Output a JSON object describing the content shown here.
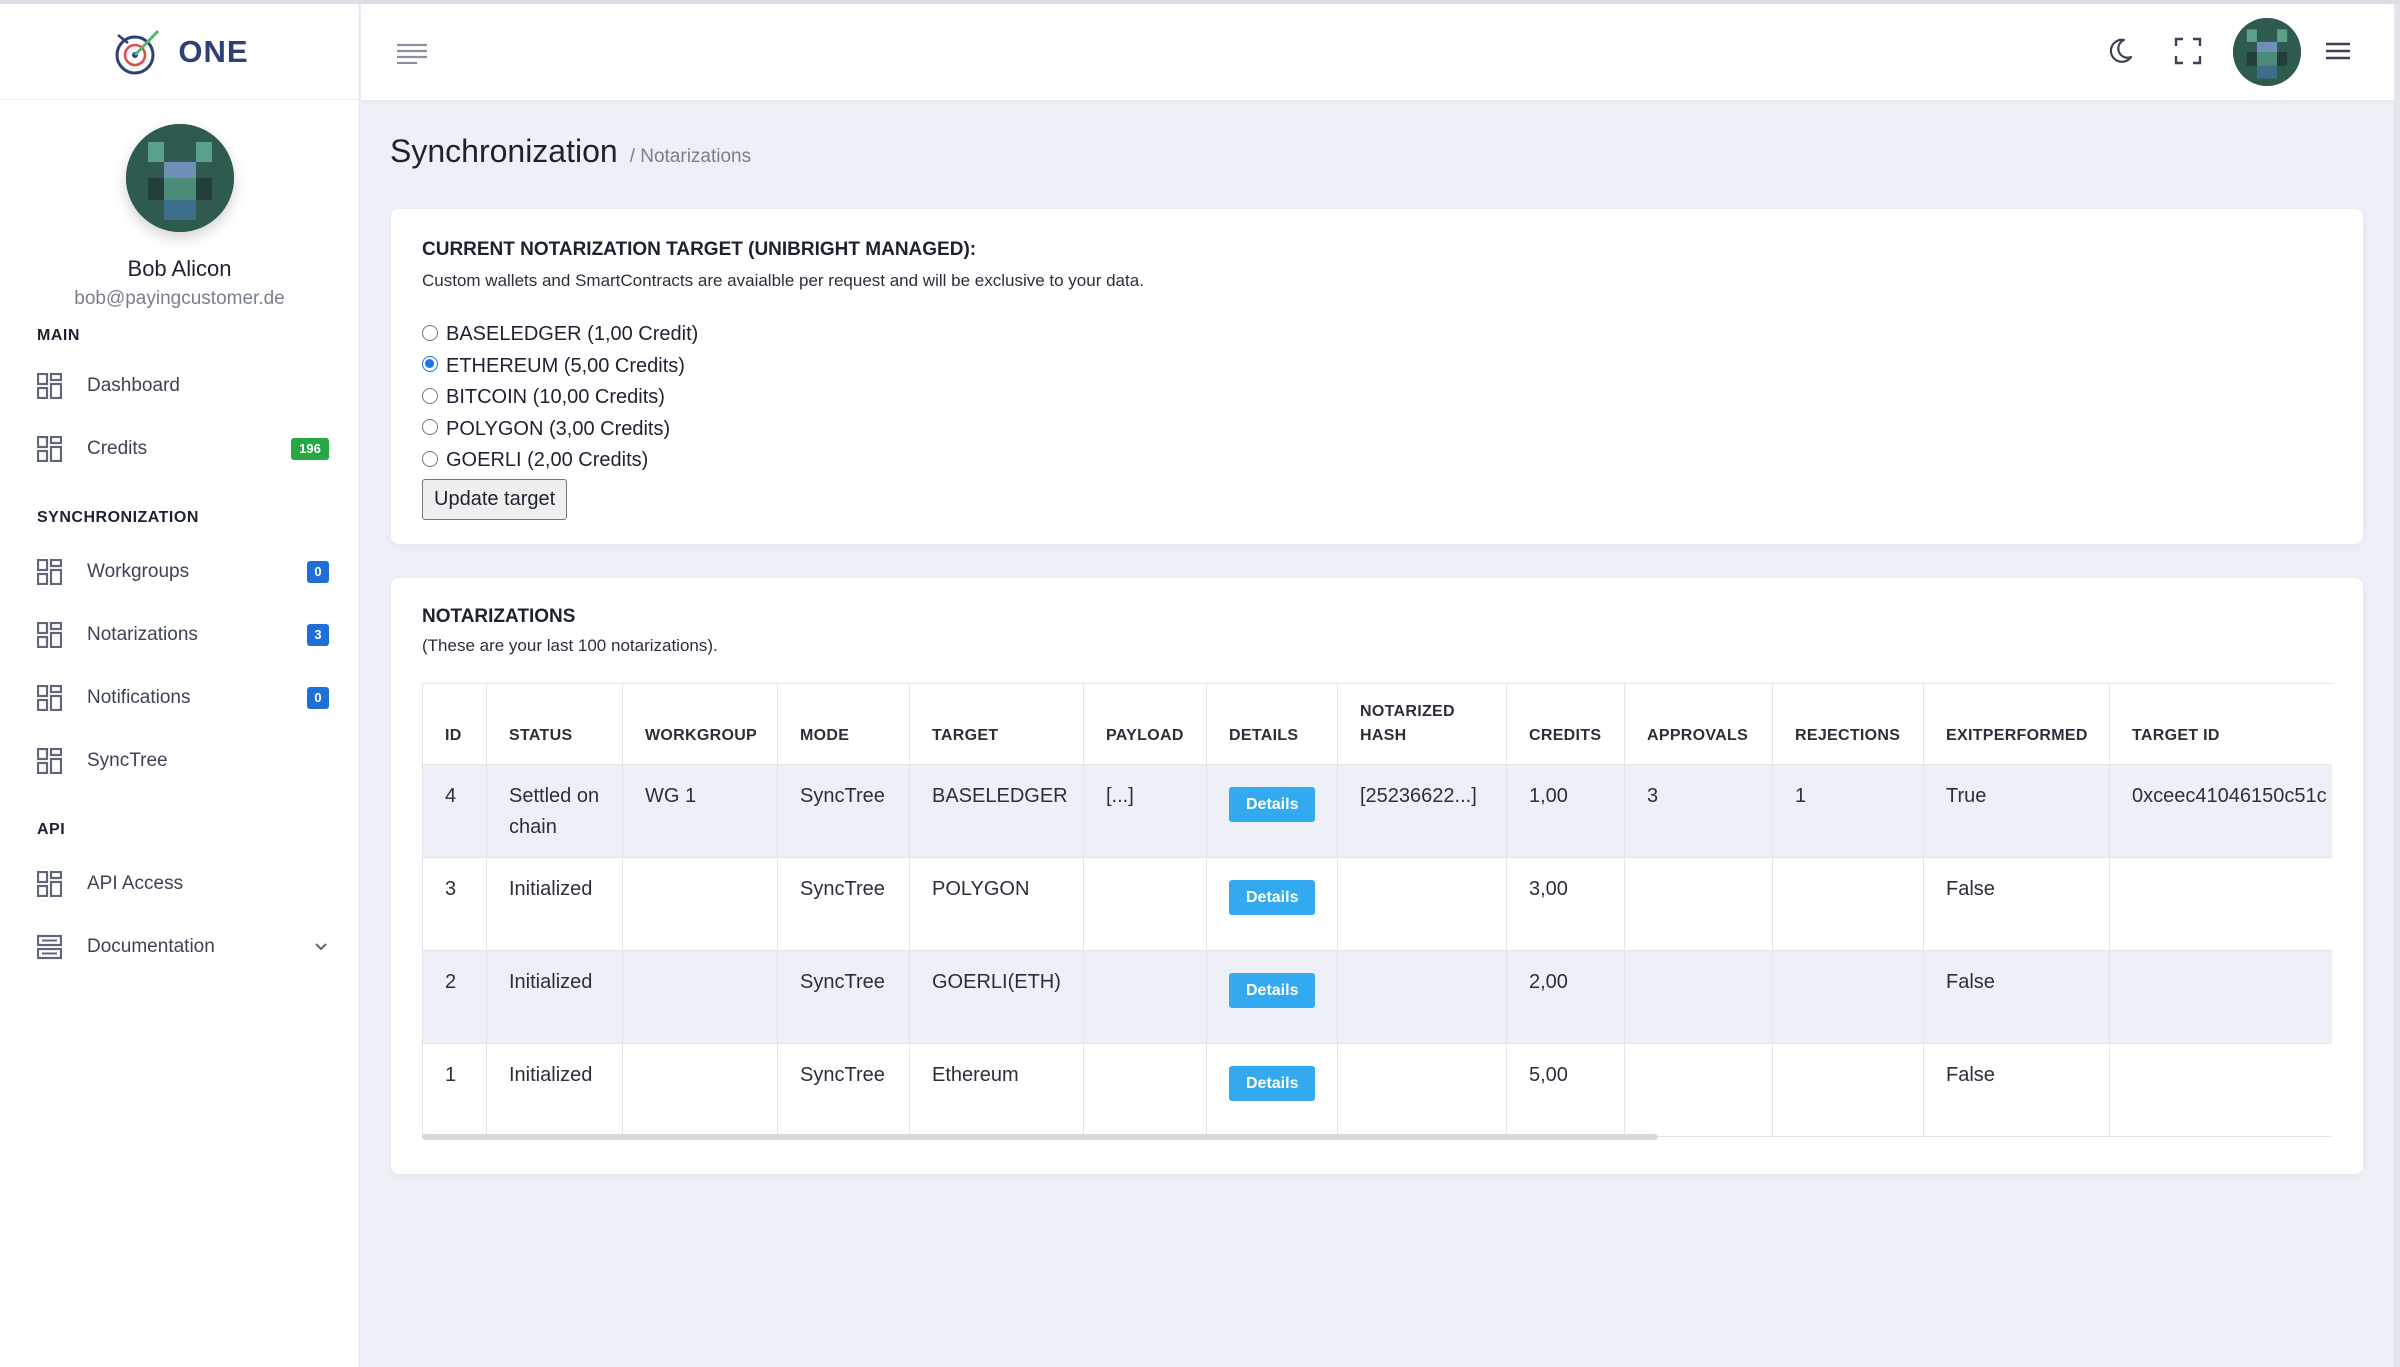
{
  "brand": {
    "name": "ONE"
  },
  "profile": {
    "name": "Bob Alicon",
    "email": "bob@payingcustomer.de"
  },
  "sidebar": {
    "sections": [
      {
        "heading": "MAIN",
        "items": [
          {
            "label": "Dashboard",
            "badge": ""
          },
          {
            "label": "Credits",
            "badge": "196"
          }
        ]
      },
      {
        "heading": "SYNCHRONIZATION",
        "items": [
          {
            "label": "Workgroups",
            "badge": "0"
          },
          {
            "label": "Notarizations",
            "badge": "3"
          },
          {
            "label": "Notifications",
            "badge": "0"
          },
          {
            "label": "SyncTree",
            "badge": ""
          }
        ]
      },
      {
        "heading": "API",
        "items": [
          {
            "label": "API Access",
            "badge": ""
          },
          {
            "label": "Documentation",
            "badge": ""
          }
        ]
      }
    ]
  },
  "header": {
    "icons": [
      "hamburger-icon",
      "moon-icon",
      "fullscreen-icon",
      "menu-icon"
    ]
  },
  "page": {
    "title": "Synchronization",
    "breadcrumb": "/ Notarizations"
  },
  "target_card": {
    "title": "CURRENT NOTARIZATION TARGET (UNIBRIGHT MANAGED):",
    "subtitle": "Custom wallets and SmartContracts are avaialble per request and will be exclusive to your data.",
    "options": [
      {
        "label": "BASELEDGER (1,00 Credit)",
        "checked": false
      },
      {
        "label": "ETHEREUM (5,00 Credits)",
        "checked": true
      },
      {
        "label": "BITCOIN (10,00 Credits)",
        "checked": false
      },
      {
        "label": "POLYGON (3,00 Credits)",
        "checked": false
      },
      {
        "label": "GOERLI (2,00 Credits)",
        "checked": false
      }
    ],
    "update_label": "Update target"
  },
  "notarizations": {
    "title": "NOTARIZATIONS",
    "subtitle": "(These are your last 100 notarizations).",
    "columns": [
      "ID",
      "STATUS",
      "WORKGROUP",
      "MODE",
      "TARGET",
      "PAYLOAD",
      "DETAILS",
      "NOTARIZED HASH",
      "CREDITS",
      "APPROVALS",
      "REJECTIONS",
      "EXITPERFORMED",
      "TARGET ID"
    ],
    "details_label": "Details",
    "rows": [
      {
        "id": "4",
        "status": "Settled on chain",
        "workgroup": "WG 1",
        "mode": "SyncTree",
        "target": "BASELEDGER",
        "payload": "[...]",
        "hash": "[25236622...]",
        "credits": "1,00",
        "approvals": "3",
        "rejections": "1",
        "exit": "True",
        "target_id": "0xceec41046150c51c"
      },
      {
        "id": "3",
        "status": "Initialized",
        "workgroup": "",
        "mode": "SyncTree",
        "target": "POLYGON",
        "payload": "",
        "hash": "",
        "credits": "3,00",
        "approvals": "",
        "rejections": "",
        "exit": "False",
        "target_id": ""
      },
      {
        "id": "2",
        "status": "Initialized",
        "workgroup": "",
        "mode": "SyncTree",
        "target": "GOERLI(ETH)",
        "payload": "",
        "hash": "",
        "credits": "2,00",
        "approvals": "",
        "rejections": "",
        "exit": "False",
        "target_id": ""
      },
      {
        "id": "1",
        "status": "Initialized",
        "workgroup": "",
        "mode": "SyncTree",
        "target": "Ethereum",
        "payload": "",
        "hash": "",
        "credits": "5,00",
        "approvals": "",
        "rejections": "",
        "exit": "False",
        "target_id": ""
      }
    ]
  },
  "colors": {
    "accent": "#1f6fd6",
    "details_button": "#33aaf0",
    "badge_green": "#28a745",
    "brand": "#2e3f7a"
  }
}
